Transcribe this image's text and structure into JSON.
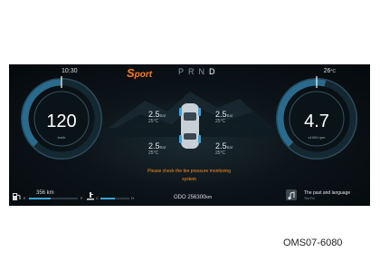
{
  "status": {
    "time": "10:30",
    "temperature": "26",
    "temperature_unit": "°C"
  },
  "drive_mode": {
    "first_letter": "S",
    "rest": "port"
  },
  "gear": {
    "options": [
      "P",
      "R",
      "N",
      "D"
    ],
    "selected": "D"
  },
  "speedometer": {
    "value": "120",
    "unit": "km/h",
    "level": 0.5
  },
  "tachometer": {
    "value": "4.7",
    "unit": "x1000 rpm",
    "level": 0.55
  },
  "tires": {
    "front_left": {
      "pressure": "2.5",
      "pressure_unit": "Bar",
      "temp": "25",
      "temp_unit": "°C"
    },
    "front_right": {
      "pressure": "2.5",
      "pressure_unit": "Bar",
      "temp": "25",
      "temp_unit": "°C"
    },
    "rear_left": {
      "pressure": "2.5",
      "pressure_unit": "Bar",
      "temp": "25",
      "temp_unit": "°C"
    },
    "rear_right": {
      "pressure": "2.5",
      "pressure_unit": "Bar",
      "temp": "25",
      "temp_unit": "°C"
    },
    "warning": "Please check the tire pressure monitoring system"
  },
  "odometer": {
    "label": "ODO",
    "value": "256300",
    "unit": "km"
  },
  "fuel": {
    "range": "356 km",
    "empty_label": "E",
    "full_label": "F",
    "level": 0.45
  },
  "coolant": {
    "cold_label": "C",
    "hot_label": "H",
    "level": 0.5
  },
  "media": {
    "title": "The past and language",
    "artist": "The Fin"
  },
  "caption": "OMS07-6080",
  "colors": {
    "accent_blue": "#3aa3d8",
    "sport_orange": "#ff7a1a",
    "warning_orange": "#ff8a1e"
  }
}
